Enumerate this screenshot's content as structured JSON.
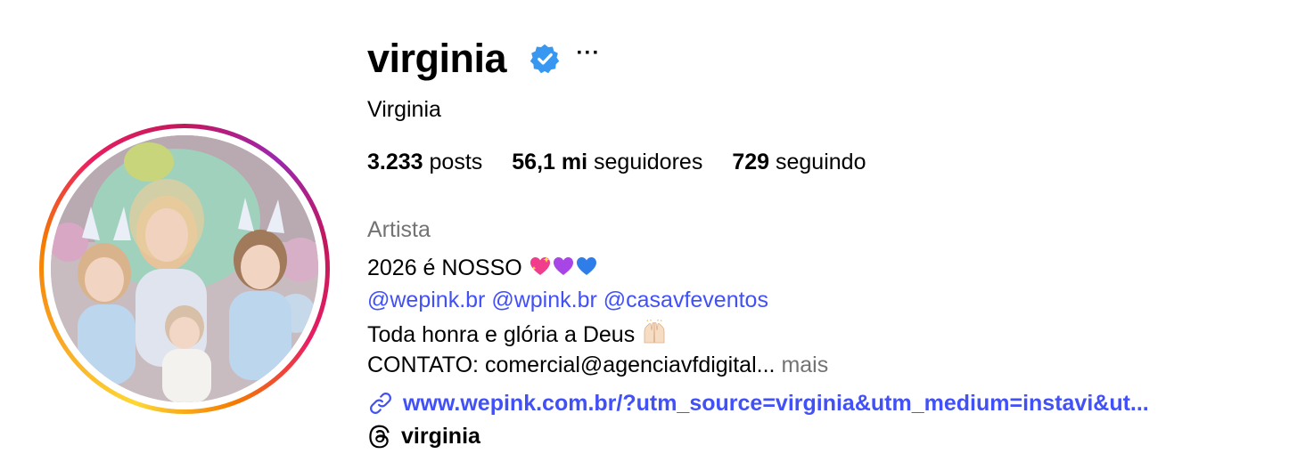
{
  "profile": {
    "username": "virginia",
    "full_name": "Virginia",
    "verified_icon": "verified-badge-icon",
    "more_icon": "more-options-icon"
  },
  "stats": {
    "posts_count": "3.233",
    "posts_label": "posts",
    "followers_count": "56,1 mi",
    "followers_label": "seguidores",
    "following_count": "729",
    "following_label": "seguindo"
  },
  "bio": {
    "category": "Artista",
    "line1_text": "2026 é NOSSO",
    "line1_emojis": [
      "sparkling-heart",
      "purple-heart",
      "blue-heart"
    ],
    "mentions": [
      "@wepink.br",
      "@wpink.br",
      "@casavfeventos"
    ],
    "line3_text": "Toda honra e glória a Deus",
    "line3_emoji": "raising-hands",
    "line4_text": "CONTATO: comercial@agenciavfdigital...",
    "more_label": "mais"
  },
  "link": {
    "icon": "link-icon",
    "url_text": "www.wepink.com.br/?utm_source=virginia&utm_medium=instavi&ut..."
  },
  "threads": {
    "icon": "threads-icon",
    "label": "virginia"
  },
  "colors": {
    "link_blue": "#4150f7",
    "secondary_gray": "#737373",
    "verified_blue": "#3897f0"
  }
}
